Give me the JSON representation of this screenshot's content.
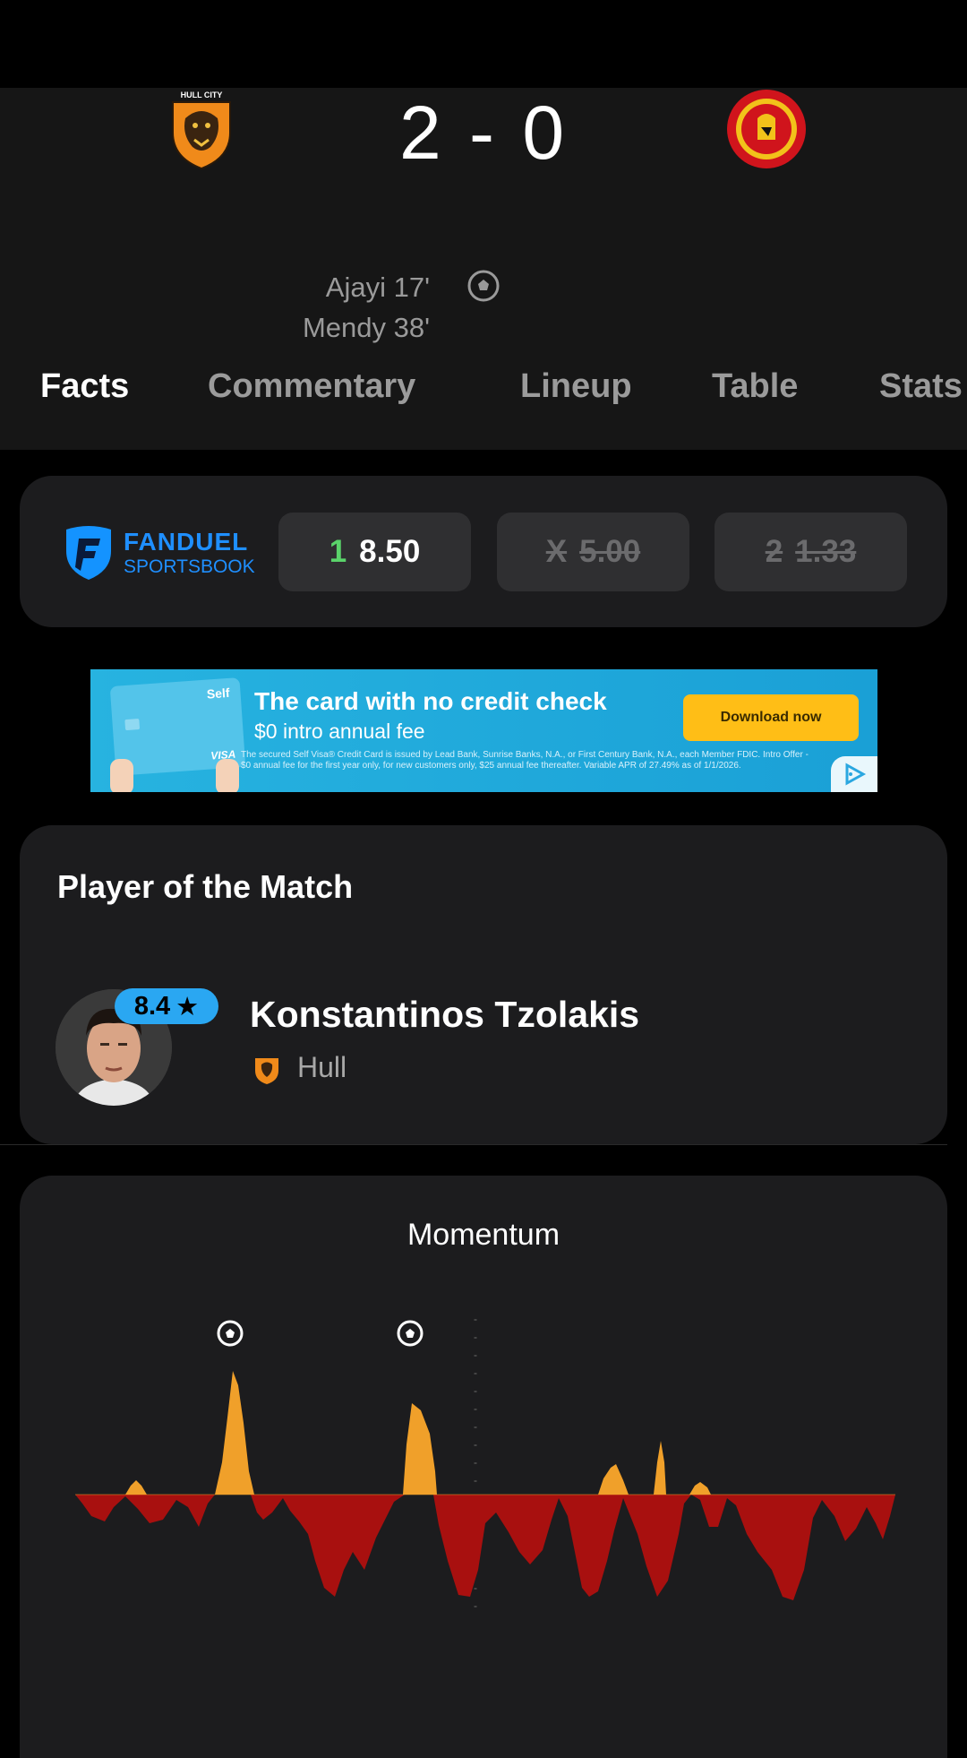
{
  "match": {
    "home_team": "Hull City",
    "away_team": "Manchester United",
    "score": "2 - 0",
    "scorers": [
      "Ajayi 17'",
      "Mendy 38'"
    ]
  },
  "tabs": [
    "Facts",
    "Commentary",
    "Lineup",
    "Table",
    "Stats"
  ],
  "odds": {
    "brand_line1": "FANDUEL",
    "brand_line2": "SPORTSBOOK",
    "items": [
      {
        "label": "1",
        "value": "8.50",
        "disabled": false
      },
      {
        "label": "X",
        "value": "5.00",
        "disabled": true
      },
      {
        "label": "2",
        "value": "1.33",
        "disabled": true
      }
    ]
  },
  "ad": {
    "title": "The card with no credit check",
    "subtitle": "$0 intro annual fee",
    "fine_print": "The secured Self Visa® Credit Card is issued by Lead Bank, Sunrise Banks, N.A., or First Century Bank, N.A., each Member FDIC. Intro Offer - $0 annual fee for the first year only, for new customers only, $25 annual fee thereafter. Variable APR of 27.49% as of 1/1/2026.",
    "cta": "Download now",
    "card_brand": "Self",
    "card_network": "VISA"
  },
  "potm": {
    "title": "Player of the Match",
    "rating": "8.4",
    "name": "Konstantinos Tzolakis",
    "team": "Hull"
  },
  "momentum": {
    "title": "Momentum",
    "colors": {
      "home": "#f0a02a",
      "away": "#a8100f"
    },
    "goal_markers_minutes": [
      17,
      38
    ]
  },
  "colors": {
    "background": "#000000",
    "card": "#1c1c1e",
    "accent_rating": "#2aa7f2",
    "odds_green": "#5ad36a",
    "ad_button": "#ffbe16"
  }
}
